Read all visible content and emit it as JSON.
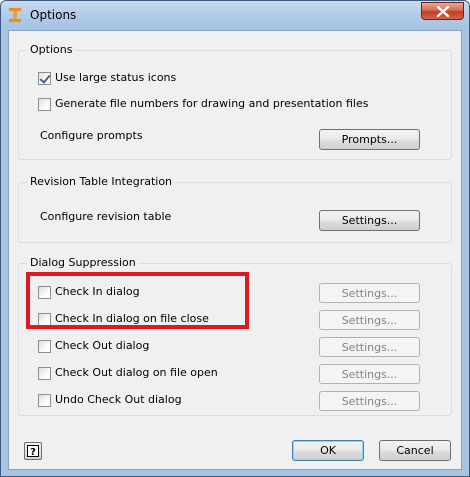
{
  "window": {
    "title": "Options"
  },
  "options_group": {
    "title": "Options",
    "use_large_icons": {
      "label": "Use large status icons",
      "checked": true
    },
    "generate_file_numbers": {
      "label": "Generate file numbers for drawing and presentation files",
      "checked": false
    },
    "configure_prompts_label": "Configure prompts",
    "prompts_button": "Prompts..."
  },
  "revision_group": {
    "title": "Revision Table Integration",
    "configure_label": "Configure revision table",
    "settings_button": "Settings..."
  },
  "suppression_group": {
    "title": "Dialog Suppression",
    "items": [
      {
        "label": "Check In dialog",
        "checked": false,
        "settings": "Settings..."
      },
      {
        "label": "Check In dialog on file close",
        "checked": false,
        "settings": "Settings..."
      },
      {
        "label": "Check Out dialog",
        "checked": false,
        "settings": "Settings..."
      },
      {
        "label": "Check Out dialog on file open",
        "checked": false,
        "settings": "Settings..."
      },
      {
        "label": "Undo Check Out dialog",
        "checked": false,
        "settings": "Settings..."
      }
    ]
  },
  "footer": {
    "ok": "OK",
    "cancel": "Cancel"
  },
  "colors": {
    "highlight": "#e0191e",
    "close_button": "#c13e22"
  }
}
